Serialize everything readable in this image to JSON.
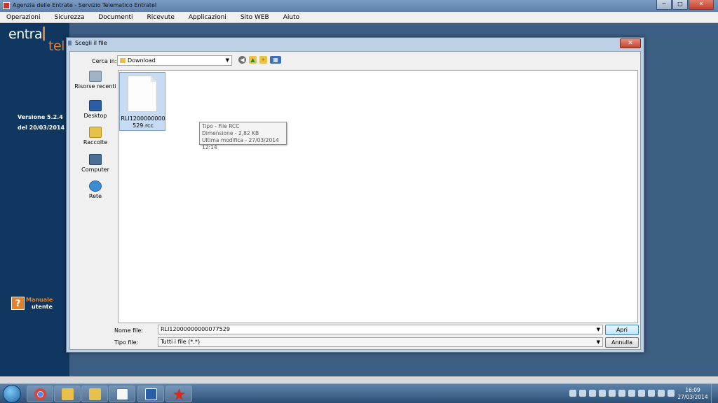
{
  "window": {
    "title": "Agenzia delle Entrate - Servizio Telematico Entratel",
    "controls": {
      "minimize": "─",
      "maximize": "□",
      "close": "✕"
    }
  },
  "menu": [
    "Operazioni",
    "Sicurezza",
    "Documenti",
    "Ricevute",
    "Applicazioni",
    "Sito WEB",
    "Aiuto"
  ],
  "sidebar": {
    "logo_top": "entra",
    "logo_bottom": "tel",
    "version": "Versione 5.2.4",
    "date": "del 20/03/2014",
    "manual_q": "?",
    "manual_line1": "Manuale",
    "manual_line2": "utente"
  },
  "dialog": {
    "title": "Scegli il file",
    "close": "✕",
    "look_in_label": "Cerca in:",
    "look_in_value": "Download",
    "places": [
      "Risorse recenti",
      "Desktop",
      "Raccolte",
      "Computer",
      "Rete"
    ],
    "file": {
      "name_line1": "RLI1200000000",
      "name_line2": "529.rcc"
    },
    "tooltip": {
      "line1": "Tipo - File RCC",
      "line2": "Dimensione - 2,82 KB",
      "line3": "Ultima modifica - 27/03/2014 12:14"
    },
    "file_name_label": "Nome file:",
    "file_name_value": "RLI12000000000077529",
    "file_type_label": "Tipo file:",
    "file_type_value": "Tutti i file (*.*)",
    "open_button": "Apri",
    "cancel_button": "Annulla"
  },
  "taskbar": {
    "time": "16:09",
    "date": "27/03/2014"
  }
}
